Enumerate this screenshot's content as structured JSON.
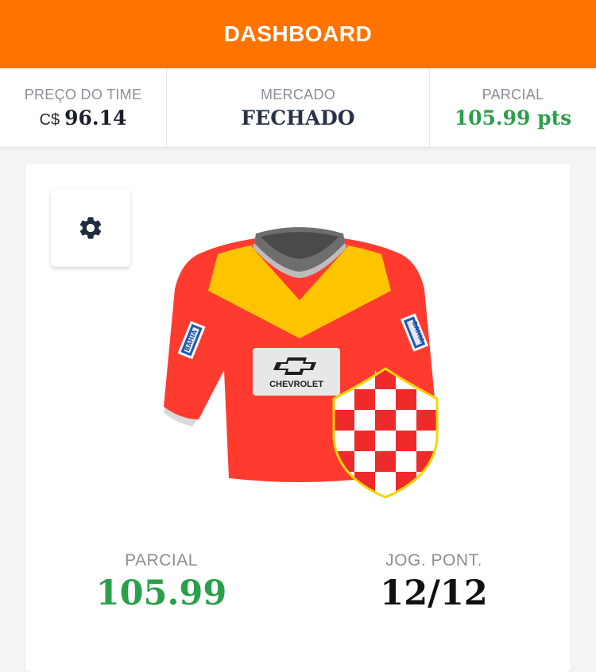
{
  "header": {
    "title": "DASHBOARD",
    "bg_color": "#ff7300"
  },
  "stats": {
    "team_price": {
      "label": "PREÇO DO TIME",
      "currency": "C$",
      "value": "96.14"
    },
    "market": {
      "label": "MERCADO",
      "value": "FECHADO"
    },
    "partial": {
      "label": "PARCIAL",
      "value": "105.99 pts",
      "color": "#2aa04a"
    }
  },
  "card": {
    "settings_icon": "gear-icon",
    "jersey": {
      "primary_color": "#ff3b2f",
      "chevron_color": "#ffc400",
      "collar_color": "#4a4a4a",
      "sponsor": "CHEVROLET",
      "sleeve_patch": "BAHIA"
    },
    "crest": {
      "pattern": "red-white-checkered",
      "border_color": "#f5d400"
    },
    "partial": {
      "label": "PARCIAL",
      "value": "105.99"
    },
    "scored_players": {
      "label": "JOG. PONT.",
      "value": "12/12"
    }
  }
}
